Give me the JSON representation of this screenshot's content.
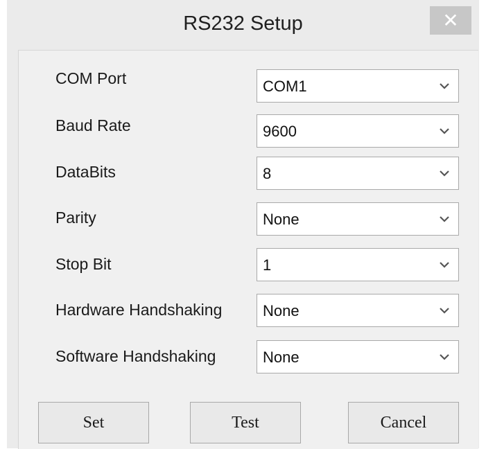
{
  "window": {
    "title": "RS232 Setup",
    "close_glyph": "✕"
  },
  "fields": [
    {
      "label": "COM Port",
      "value": "COM1"
    },
    {
      "label": "Baud Rate",
      "value": "9600"
    },
    {
      "label": "DataBits",
      "value": "8"
    },
    {
      "label": "Parity",
      "value": "None"
    },
    {
      "label": "Stop Bit",
      "value": "1"
    },
    {
      "label": "Hardware Handshaking",
      "value": "None"
    },
    {
      "label": "Software Handshaking",
      "value": "None"
    }
  ],
  "buttons": {
    "set": "Set",
    "test": "Test",
    "cancel": "Cancel"
  },
  "icons": {
    "dropdown": "chevron-down-icon",
    "close": "close-icon"
  },
  "colors": {
    "window_bg": "#ebebeb",
    "client_bg": "#f0f0f0",
    "close_bg": "#c7c7c7"
  }
}
